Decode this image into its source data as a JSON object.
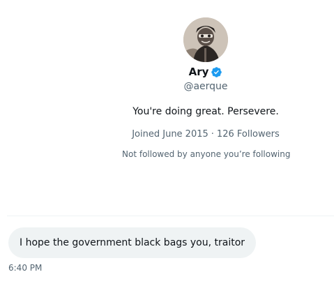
{
  "profile": {
    "name": "Ary",
    "verified": true,
    "handle": "@aerque",
    "bio": "You're doing great. Persevere.",
    "joined": "Joined June 2015",
    "separator": "·",
    "followers": "126 Followers",
    "followed_note": "Not followed by anyone you’re following",
    "avatar_icon": "user-avatar"
  },
  "conversation": {
    "messages": [
      {
        "text": "I hope the government black bags you, traitor",
        "time": "6:40 PM"
      }
    ]
  },
  "colors": {
    "verified_badge": "#1d9bf0",
    "primary_text": "#0f1419",
    "secondary_text": "#536471",
    "bubble_bg": "#eff3f4"
  }
}
